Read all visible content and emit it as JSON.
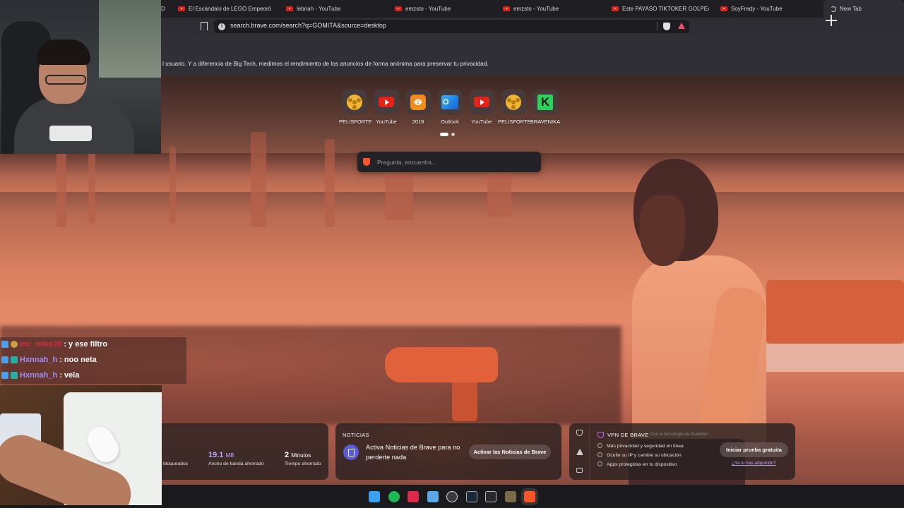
{
  "browser": {
    "tabs": [
      {
        "title": "D",
        "icon": "youtube-icon",
        "active": false
      },
      {
        "title": "El Escándalo de LEGO Empeoró - You",
        "icon": "youtube-icon",
        "active": false
      },
      {
        "title": "lebriah - YouTube",
        "icon": "youtube-icon",
        "active": false
      },
      {
        "title": "emzsto - YouTube",
        "icon": "youtube-icon",
        "active": false
      },
      {
        "title": "emzsto - YouTube",
        "icon": "youtube-icon",
        "active": false
      },
      {
        "title": "Este PAYASO TIKTOKER GOLPEA MUJ",
        "icon": "youtube-icon",
        "active": false
      },
      {
        "title": "SoyFredy - YouTube",
        "icon": "youtube-icon",
        "active": false
      },
      {
        "title": "New Tab",
        "icon": "loading-icon",
        "active": true
      }
    ],
    "url": "search.brave.com/search?q=GOMITA&source=desktop",
    "banner": "l usuario. Y a diferencia de Big Tech, medimos el rendimiento de los anuncios de forma anónima para preservar tu privacidad."
  },
  "newtab": {
    "top_sites": [
      {
        "label": "PELISFORTE",
        "icon": "film-reel-icon"
      },
      {
        "label": "YouTube",
        "icon": "youtube-icon"
      },
      {
        "label": "2018",
        "icon": "odnoklassniki-icon"
      },
      {
        "label": "Outlook",
        "icon": "outlook-icon"
      },
      {
        "label": "YouTube",
        "icon": "youtube-icon"
      },
      {
        "label": "PELISFORTE",
        "icon": "film-reel-icon"
      },
      {
        "label": "BRAVENIKA",
        "icon": "kick-icon"
      }
    ],
    "search_placeholder": "Pregunta, encuentra...",
    "stats": {
      "blocked_label": "bloqueados",
      "bandwidth_value": "19.1",
      "bandwidth_unit": "MB",
      "bandwidth_label": "Ancho de banda ahorrado",
      "time_value": "2",
      "time_unit": "Minutos",
      "time_label": "Tiempo ahorrado"
    },
    "news": {
      "title": "NOTICIAS",
      "text": "Activa Noticias de Brave para no perderte nada",
      "button": "Activar las Noticias de Brave"
    },
    "vpn": {
      "title": "VPN DE BRAVE",
      "powered_by": "Con la tecnología de Guardian",
      "items": [
        "Más privacidad y seguridad en línea",
        "Oculte su IP y cambie su ubicación",
        "Apps protegidas en tu dispositivo"
      ],
      "button": "Iniciar prueba gratuita",
      "link": "¿Ya lo has adquirido?"
    }
  },
  "stream_chat": [
    {
      "user": "mc_mike29",
      "message": ": y ese filtro",
      "user_color": "#d12b3f"
    },
    {
      "user": "Hxnnah_h",
      "message": ": noo neta",
      "user_color": "#a48cff"
    },
    {
      "user": "Hxnnah_h",
      "message": ": vela",
      "user_color": "#a48cff"
    }
  ],
  "taskbar": {
    "icons": [
      {
        "name": "windows-start-icon",
        "color": "#3aa0f2"
      },
      {
        "name": "spotify-icon",
        "color": "#1db954"
      },
      {
        "name": "pen-app-icon",
        "color": "#e0284d"
      },
      {
        "name": "file-explorer-icon",
        "color": "#5aa9e6"
      },
      {
        "name": "obs-icon",
        "color": "#3a3a3a"
      },
      {
        "name": "steam-icon",
        "color": "#1b2838"
      },
      {
        "name": "epic-games-icon",
        "color": "#2a2a2a"
      },
      {
        "name": "game-app-icon",
        "color": "#7a6a4a"
      },
      {
        "name": "brave-browser-icon",
        "color": "#fb542b"
      }
    ]
  }
}
